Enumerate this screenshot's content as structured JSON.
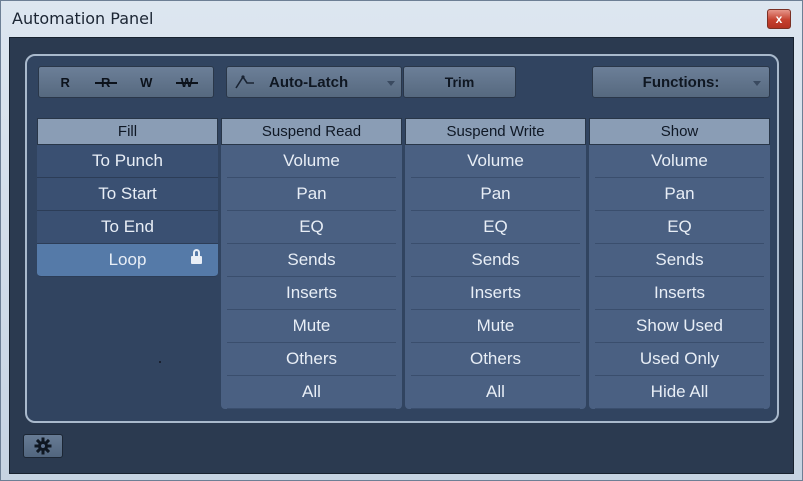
{
  "window": {
    "title": "Automation Panel",
    "close_label": "x"
  },
  "toolbar": {
    "rw_buttons": [
      {
        "label": "R",
        "icon": "read-icon"
      },
      {
        "label": "R",
        "icon": "read-disable-icon"
      },
      {
        "label": "W",
        "icon": "write-icon"
      },
      {
        "label": "W",
        "icon": "write-disable-icon"
      }
    ],
    "mode_label": "Auto-Latch",
    "trim_label": "Trim",
    "functions_label": "Functions:"
  },
  "columns": {
    "fill": {
      "header": "Fill",
      "items": [
        "To Punch",
        "To Start",
        "To End",
        "Loop"
      ],
      "selected": "Loop"
    },
    "suspend_read": {
      "header": "Suspend Read",
      "items": [
        "Volume",
        "Pan",
        "EQ",
        "Sends",
        "Inserts",
        "Mute",
        "Others",
        "All"
      ]
    },
    "suspend_write": {
      "header": "Suspend Write",
      "items": [
        "Volume",
        "Pan",
        "EQ",
        "Sends",
        "Inserts",
        "Mute",
        "Others",
        "All"
      ]
    },
    "show": {
      "header": "Show",
      "items": [
        "Volume",
        "Pan",
        "EQ",
        "Sends",
        "Inserts",
        "Show Used",
        "Used Only",
        "Hide All"
      ]
    }
  },
  "colors": {
    "panel_bg": "#314460",
    "column_bg": "#4a6082",
    "header_bg": "#8a9db5",
    "selected_bg": "#557aa8"
  }
}
